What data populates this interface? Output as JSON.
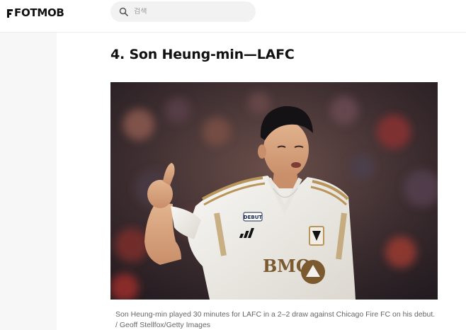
{
  "header": {
    "logo_text": "FOTMOB",
    "search_placeholder": "검색"
  },
  "article": {
    "section_heading": "4. Son Heung-min—LAFC",
    "image_alt": "Son Heung-min giving a thumbs up in an LAFC jersey",
    "caption": "Son Heung-min played 30 minutes for LAFC in a 2–2 draw against Chicago Fire FC on his debut.",
    "credit": "/ Geoff Stellfox/Getty Images",
    "jersey_sponsor": "BMO",
    "jersey_patch": "DEBUT"
  },
  "colors": {
    "jersey": "#f4f2ee",
    "jersey_trim": "#b8955a",
    "background_crowd": "#3a2a2c"
  }
}
